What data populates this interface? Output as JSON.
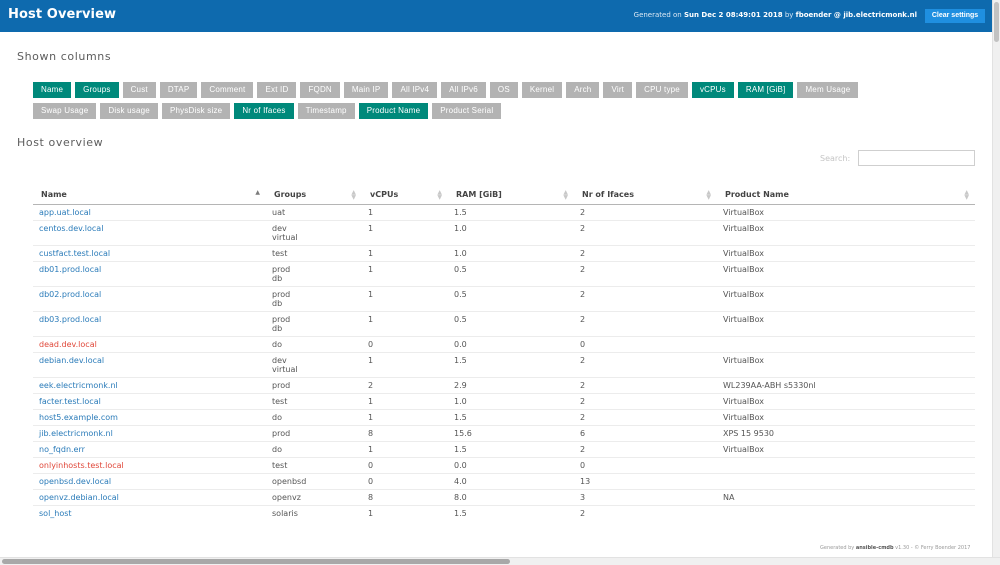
{
  "header": {
    "title": "Host Overview",
    "generated_prefix": "Generated on",
    "generated_date": "Sun Dec 2 08:49:01 2018",
    "generated_by_word": "by",
    "generated_user": "fboender @ jib.electricmonk.nl",
    "clear_label": "Clear settings"
  },
  "shown_columns": {
    "title": "Shown columns",
    "rows": [
      [
        {
          "label": "Name",
          "on": true
        },
        {
          "label": "Groups",
          "on": true
        },
        {
          "label": "Cust",
          "on": false
        },
        {
          "label": "DTAP",
          "on": false
        },
        {
          "label": "Comment",
          "on": false
        },
        {
          "label": "Ext ID",
          "on": false
        },
        {
          "label": "FQDN",
          "on": false
        },
        {
          "label": "Main IP",
          "on": false
        },
        {
          "label": "All IPv4",
          "on": false
        },
        {
          "label": "All IPv6",
          "on": false
        },
        {
          "label": "OS",
          "on": false
        },
        {
          "label": "Kernel",
          "on": false
        },
        {
          "label": "Arch",
          "on": false
        },
        {
          "label": "Virt",
          "on": false
        },
        {
          "label": "CPU type",
          "on": false
        },
        {
          "label": "vCPUs",
          "on": true
        },
        {
          "label": "RAM [GiB]",
          "on": true
        },
        {
          "label": "Mem Usage",
          "on": false
        }
      ],
      [
        {
          "label": "Swap Usage",
          "on": false
        },
        {
          "label": "Disk usage",
          "on": false
        },
        {
          "label": "PhysDisk size",
          "on": false
        },
        {
          "label": "Nr of Ifaces",
          "on": true
        },
        {
          "label": "Timestamp",
          "on": false
        },
        {
          "label": "Product Name",
          "on": true
        },
        {
          "label": "Product Serial",
          "on": false
        }
      ]
    ]
  },
  "host_overview": {
    "title": "Host overview",
    "search_label": "Search:",
    "search_value": "",
    "columns": [
      "Name",
      "Groups",
      "vCPUs",
      "RAM [GiB]",
      "Nr of Ifaces",
      "Product Name"
    ],
    "rows": [
      {
        "name": "app.uat.local",
        "groups": [
          "uat"
        ],
        "vcpus": "1",
        "ram": "1.5",
        "ifaces": "2",
        "product": "VirtualBox",
        "down": false
      },
      {
        "name": "centos.dev.local",
        "groups": [
          "dev",
          "virtual"
        ],
        "vcpus": "1",
        "ram": "1.0",
        "ifaces": "2",
        "product": "VirtualBox",
        "down": false
      },
      {
        "name": "custfact.test.local",
        "groups": [
          "test"
        ],
        "vcpus": "1",
        "ram": "1.0",
        "ifaces": "2",
        "product": "VirtualBox",
        "down": false
      },
      {
        "name": "db01.prod.local",
        "groups": [
          "prod",
          "db"
        ],
        "vcpus": "1",
        "ram": "0.5",
        "ifaces": "2",
        "product": "VirtualBox",
        "down": false
      },
      {
        "name": "db02.prod.local",
        "groups": [
          "prod",
          "db"
        ],
        "vcpus": "1",
        "ram": "0.5",
        "ifaces": "2",
        "product": "VirtualBox",
        "down": false
      },
      {
        "name": "db03.prod.local",
        "groups": [
          "prod",
          "db"
        ],
        "vcpus": "1",
        "ram": "0.5",
        "ifaces": "2",
        "product": "VirtualBox",
        "down": false
      },
      {
        "name": "dead.dev.local",
        "groups": [
          "do"
        ],
        "vcpus": "0",
        "ram": "0.0",
        "ifaces": "0",
        "product": "",
        "down": true
      },
      {
        "name": "debian.dev.local",
        "groups": [
          "dev",
          "virtual"
        ],
        "vcpus": "1",
        "ram": "1.5",
        "ifaces": "2",
        "product": "VirtualBox",
        "down": false
      },
      {
        "name": "eek.electricmonk.nl",
        "groups": [
          "prod"
        ],
        "vcpus": "2",
        "ram": "2.9",
        "ifaces": "2",
        "product": "WL239AA-ABH s5330nl",
        "down": false
      },
      {
        "name": "facter.test.local",
        "groups": [
          "test"
        ],
        "vcpus": "1",
        "ram": "1.0",
        "ifaces": "2",
        "product": "VirtualBox",
        "down": false
      },
      {
        "name": "host5.example.com",
        "groups": [
          "do"
        ],
        "vcpus": "1",
        "ram": "1.5",
        "ifaces": "2",
        "product": "VirtualBox",
        "down": false
      },
      {
        "name": "jib.electricmonk.nl",
        "groups": [
          "prod"
        ],
        "vcpus": "8",
        "ram": "15.6",
        "ifaces": "6",
        "product": "XPS 15 9530",
        "down": false
      },
      {
        "name": "no_fqdn.err",
        "groups": [
          "do"
        ],
        "vcpus": "1",
        "ram": "1.5",
        "ifaces": "2",
        "product": "VirtualBox",
        "down": false
      },
      {
        "name": "onlyinhosts.test.local",
        "groups": [
          "test"
        ],
        "vcpus": "0",
        "ram": "0.0",
        "ifaces": "0",
        "product": "",
        "down": true
      },
      {
        "name": "openbsd.dev.local",
        "groups": [
          "openbsd"
        ],
        "vcpus": "0",
        "ram": "4.0",
        "ifaces": "13",
        "product": "",
        "down": false
      },
      {
        "name": "openvz.debian.local",
        "groups": [
          "openvz"
        ],
        "vcpus": "8",
        "ram": "8.0",
        "ifaces": "3",
        "product": "NA",
        "down": false
      },
      {
        "name": "sol_host",
        "groups": [
          "solaris"
        ],
        "vcpus": "1",
        "ram": "1.5",
        "ifaces": "2",
        "product": "",
        "down": false
      }
    ]
  },
  "footer": {
    "prefix": "Generated by",
    "tool": "ansible-cmdb",
    "suffix": "v1.30 - © Ferry Boender 2017"
  },
  "colors": {
    "header_bg": "#0e6aae",
    "button_on": "#00897b",
    "button_off": "#b3b3b3",
    "link": "#2a7bb9",
    "link_down": "#e0483a"
  }
}
